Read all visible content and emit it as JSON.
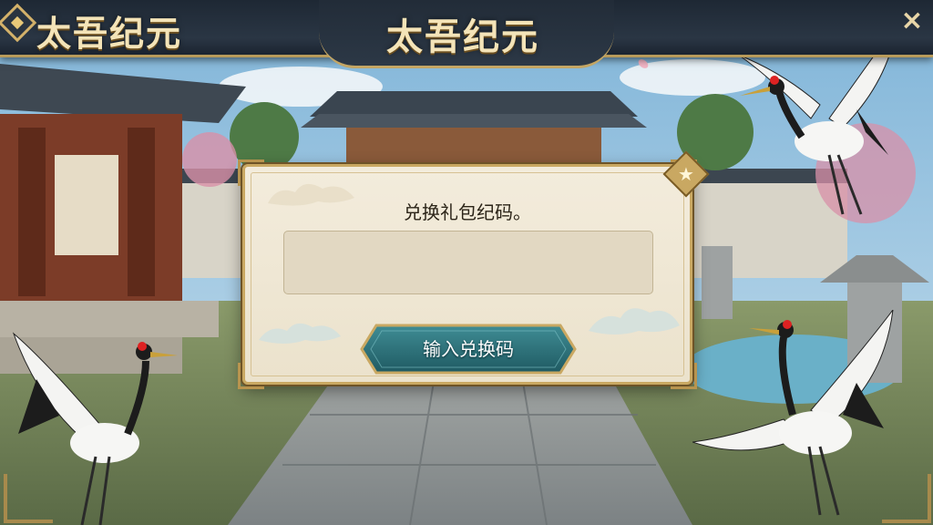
{
  "header": {
    "title_left": "太吾纪元",
    "title_center": "太吾纪元",
    "close_icon": "×"
  },
  "dialog": {
    "title": "兑换礼包纪码。",
    "input_value": "",
    "input_placeholder": "",
    "badge_icon": "★",
    "redeem_button_label": "输入兑换码"
  },
  "colors": {
    "gold_trim": "#c9a862",
    "parchment": "#f3ecdc",
    "button_teal": "#2f7a82",
    "title_text": "#f4e4b8"
  },
  "icons": [
    "logo-emblem-icon",
    "close-icon",
    "star-badge-icon",
    "crane-icon",
    "cloud-ornament-icon"
  ]
}
